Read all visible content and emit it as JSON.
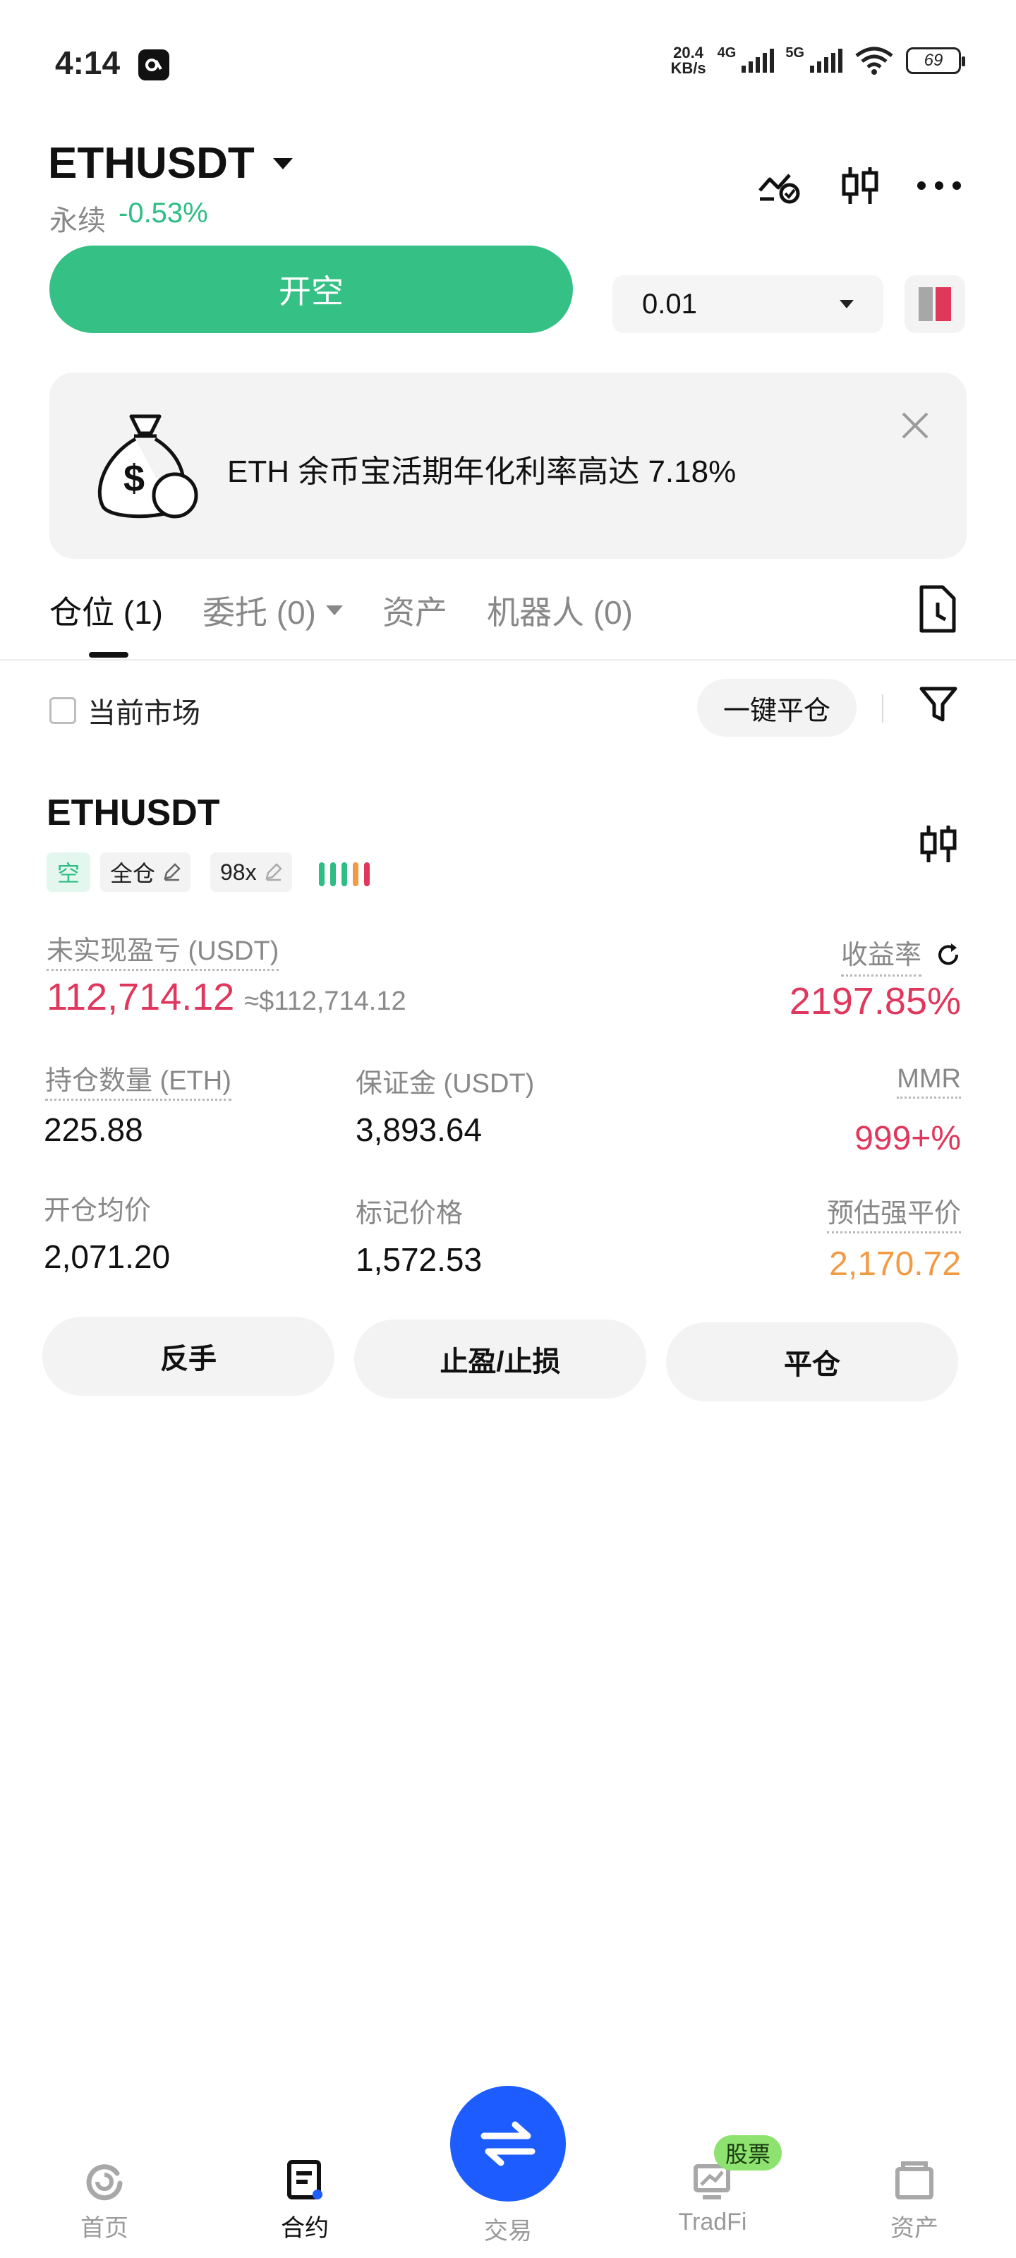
{
  "status_bar": {
    "time": "4:14",
    "app_icon": "app-badge",
    "speed_value": "20.4",
    "speed_unit": "KB/s",
    "net1": "4G",
    "net2": "5G",
    "battery": "69"
  },
  "header": {
    "symbol": "ETHUSDT",
    "contract_type": "永续",
    "change": "-0.53%",
    "open_button": "开空",
    "quantity": "0.01",
    "colors": {
      "buy_green": "#35c085",
      "sell_red": "#e0375c"
    }
  },
  "banner": {
    "text": "ETH 余币宝活期年化利率高达 7.18%"
  },
  "tabs": [
    {
      "label": "仓位 (1)",
      "active": true
    },
    {
      "label": "委托 (0)",
      "dropdown": true
    },
    {
      "label": "资产"
    },
    {
      "label": "机器人 (0)"
    }
  ],
  "filter_row": {
    "checkbox_label": "当前市场",
    "close_all": "一键平仓"
  },
  "position": {
    "symbol": "ETHUSDT",
    "side_tag": "空",
    "margin_mode": "全仓",
    "leverage": "98x",
    "unrealized_pnl_label": "未实现盈亏 (USDT)",
    "unrealized_pnl": "112,714.12",
    "unrealized_pnl_usd": "≈$112,714.12",
    "roi_label": "收益率",
    "roi": "2197.85%",
    "size_label": "持仓数量 (ETH)",
    "size": "225.88",
    "margin_label": "保证金 (USDT)",
    "margin": "3,893.64",
    "mmr_label": "MMR",
    "mmr": "999+%",
    "entry_label": "开仓均价",
    "entry": "2,071.20",
    "mark_label": "标记价格",
    "mark": "1,572.53",
    "liq_label": "预估强平价",
    "liq": "2,170.72",
    "actions": [
      "反手",
      "止盈/止损",
      "平仓"
    ]
  },
  "bottom_nav": {
    "items": [
      "首页",
      "合约",
      "交易",
      "TradFi",
      "资产"
    ],
    "active": "合约",
    "badge": "股票"
  }
}
